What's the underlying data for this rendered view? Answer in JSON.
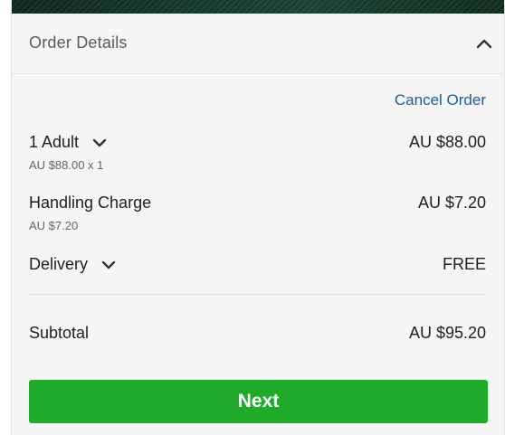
{
  "order": {
    "title": "Order Details",
    "cancel_label": "Cancel Order",
    "items": [
      {
        "label": "1 Adult",
        "detail": "AU $88.00 x 1",
        "price": "AU $88.00"
      },
      {
        "label": "Handling Charge",
        "detail": "AU $7.20",
        "price": "AU $7.20"
      },
      {
        "label": "Delivery",
        "price": "FREE"
      }
    ],
    "subtotal_label": "Subtotal",
    "subtotal_value": "AU $95.20",
    "next_label": "Next"
  },
  "colors": {
    "accent_green": "#1faa2a",
    "link_blue": "#1a5ea8",
    "panel_bg": "#f5f5f5"
  },
  "icons": [
    "chevron-up-icon",
    "chevron-down-icon"
  ]
}
